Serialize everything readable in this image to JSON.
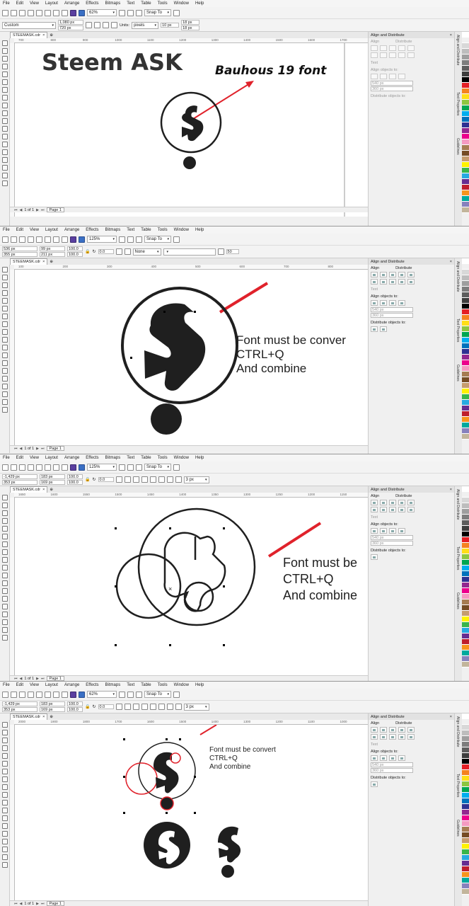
{
  "menu": [
    "File",
    "Edit",
    "View",
    "Layout",
    "Arrange",
    "Effects",
    "Bitmaps",
    "Text",
    "Table",
    "Tools",
    "Window",
    "Help"
  ],
  "panels": [
    {
      "id": "p1",
      "zoom": "62%",
      "snap": "Snap To",
      "props": {
        "preset": "Custom",
        "width": "1,080 px",
        "height": "720 px",
        "units_label": "Units:",
        "units": "pixels",
        "nudge": "10 px",
        "dup_x": "18 px",
        "dup_y": "18 px"
      },
      "tab": "STEEMASK.cdr",
      "page_count": "1 of 1",
      "page_tab": "Page 1",
      "ruler": [
        "700",
        "800",
        "900",
        "1000",
        "1100",
        "1200",
        "1300",
        "1400",
        "1500",
        "1600",
        "1700"
      ],
      "texts": {
        "heading": "Steem ASK",
        "annotation": "Bauhous 19 font"
      }
    },
    {
      "id": "p2",
      "zoom": "125%",
      "snap": "Snap To",
      "props": {
        "x": "536 px",
        "y": "355 px",
        "w": "99 px",
        "h": "211 px",
        "sx": "100.0",
        "sy": "100.0",
        "angle": "0.0",
        "outline": "None",
        "value": "50"
      },
      "tab": "STEEMASK.cdr",
      "page_count": "1 of 1",
      "page_tab": "Page 1",
      "ruler": [
        "100",
        "200",
        "300",
        "400",
        "500",
        "600",
        "700",
        "800"
      ],
      "texts": {
        "line1": "Font must be conver",
        "line2": "CTRL+Q",
        "line3": "And combine"
      }
    },
    {
      "id": "p3",
      "zoom": "125%",
      "snap": "Snap To",
      "props": {
        "x": "-1,429 px",
        "y": "353 px",
        "w": "183 px",
        "h": "169 px",
        "sx": "100.0",
        "sy": "100.0",
        "angle": "0.0",
        "stroke": "3 px"
      },
      "tab": "STEEMASK.cdr",
      "page_count": "1 of 1",
      "page_tab": "Page 1",
      "ruler": [
        "1650",
        "1600",
        "1550",
        "1500",
        "1450",
        "1400",
        "1350",
        "1300",
        "1250",
        "1200",
        "1150"
      ],
      "texts": {
        "line1": "Font must be",
        "line2": "CTRL+Q",
        "line3": "And combine"
      }
    },
    {
      "id": "p4",
      "zoom": "62%",
      "snap": "Snap To",
      "props": {
        "x": "-1,429 px",
        "y": "353 px",
        "w": "183 px",
        "h": "169 px",
        "sx": "100.0",
        "sy": "100.0",
        "angle": "0.0",
        "stroke": "3 px"
      },
      "tab": "STEEMASK.cdr",
      "page_count": "1 of 1",
      "page_tab": "Page 1",
      "ruler": [
        "2000",
        "1900",
        "1800",
        "1700",
        "1600",
        "1500",
        "1400",
        "1300",
        "1200",
        "1100",
        "1000"
      ],
      "texts": {
        "line1": "Font must be convert",
        "line2": "CTRL+Q",
        "line3": "And combine"
      }
    }
  ],
  "dock": {
    "title": "Align and Distribute",
    "align": "Align",
    "distribute": "Distribute",
    "text_label": "Text",
    "align_to": "Align objects to:",
    "align_x": "540 px",
    "align_y": "360 px",
    "distribute_to": "Distribute objects to:"
  },
  "side_tabs": {
    "align": "Align and Distribute",
    "text": "Text Properties",
    "guides": "Guidelines"
  },
  "colors": {
    "accent_red": "#e0222b",
    "glyph": "#1f1f1f",
    "palette": [
      "#ffffff",
      "#f0f0f0",
      "#d8d8d8",
      "#bdbdbd",
      "#9e9e9e",
      "#7d7d7d",
      "#5d5d5d",
      "#3d3d3d",
      "#000000",
      "#e41f26",
      "#f5821f",
      "#ffde17",
      "#8dc63f",
      "#00a651",
      "#00aeef",
      "#0072bc",
      "#2e3192",
      "#92278f",
      "#ec008c",
      "#f49ac1",
      "#a67c52",
      "#754c24",
      "#c69c6d",
      "#fff200",
      "#39b54a",
      "#27aae1",
      "#662d91",
      "#be1e2d",
      "#f7941d",
      "#00a99d",
      "#8781bd",
      "#c2b59b"
    ]
  }
}
